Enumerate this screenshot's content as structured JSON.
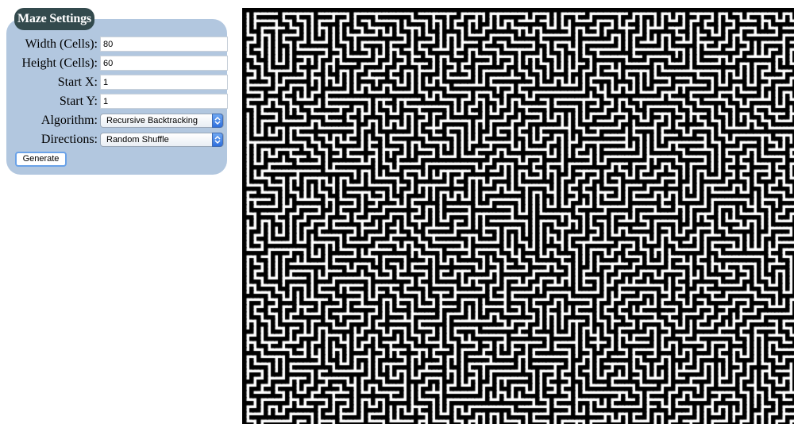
{
  "panel": {
    "title": "Maze Settings",
    "background": "#b2c7df",
    "title_background": "#334a4d"
  },
  "fields": {
    "width_label": "Width (Cells):",
    "width_value": "80",
    "height_label": "Height (Cells):",
    "height_value": "60",
    "start_x_label": "Start X:",
    "start_x_value": "1",
    "start_y_label": "Start Y:",
    "start_y_value": "1"
  },
  "selects": {
    "algorithm_label": "Algorithm:",
    "algorithm_value": "Recursive Backtracking",
    "directions_label": "Directions:",
    "directions_value": "Random Shuffle",
    "arrow_icon": "updown-chevron-icon"
  },
  "generate_label": "Generate",
  "maze": {
    "wall_color": "#000000",
    "path_color": "#ffffff"
  }
}
